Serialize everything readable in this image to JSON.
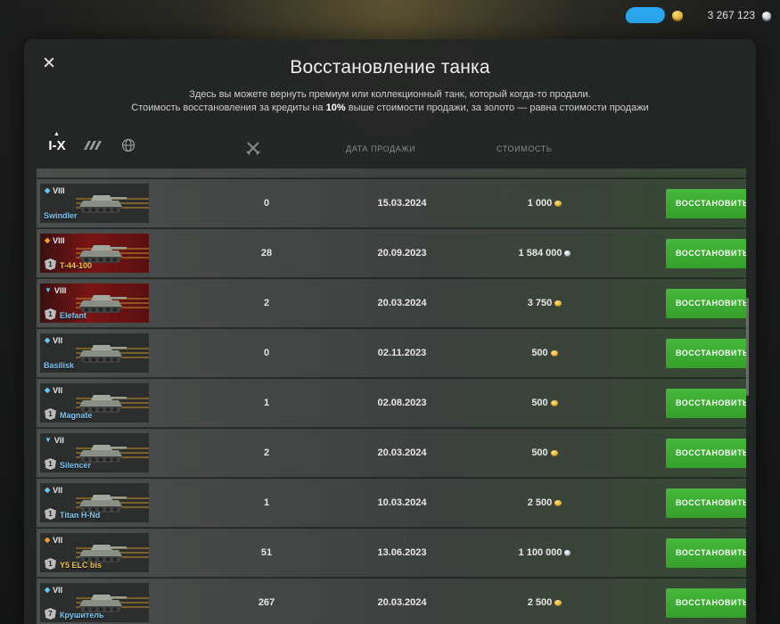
{
  "header": {
    "credits": "3 267 123"
  },
  "modal": {
    "title": "Восстановление танка",
    "desc_line1": "Здесь вы можете вернуть премиум или коллекционный танк, который когда-то продали.",
    "desc_line2_a": "Стоимость восстановления за кредиты на ",
    "desc_line2_b": "10%",
    "desc_line2_c": " выше стоимости продажи, за золото — равна стоимости продажи"
  },
  "filters": {
    "tier_label": "I-X"
  },
  "columns": {
    "date": "ДАТА ПРОДАЖИ",
    "cost": "СТОИМОСТЬ"
  },
  "restore_label": "ВОССТАНОВИТЬ",
  "rows": [
    {
      "tier": "VIII",
      "class": "light",
      "name": "Swindler",
      "battles": "0",
      "date": "15.03.2024",
      "cost": "1 000",
      "currency": "gold",
      "rank": "",
      "red": false
    },
    {
      "tier": "VIII",
      "class": "heavy",
      "name": "T-44-100",
      "battles": "28",
      "date": "20.09.2023",
      "cost": "1 584 000",
      "currency": "silver",
      "rank": "1",
      "red": true
    },
    {
      "tier": "VIII",
      "class": "td",
      "name": "Elefant",
      "battles": "2",
      "date": "20.03.2024",
      "cost": "3 750",
      "currency": "gold",
      "rank": "1",
      "red": true
    },
    {
      "tier": "VII",
      "class": "light",
      "name": "Basilisk",
      "battles": "0",
      "date": "02.11.2023",
      "cost": "500",
      "currency": "gold",
      "rank": "",
      "red": false
    },
    {
      "tier": "VII",
      "class": "light",
      "name": "Magnate",
      "battles": "1",
      "date": "02.08.2023",
      "cost": "500",
      "currency": "gold",
      "rank": "1",
      "red": false
    },
    {
      "tier": "VII",
      "class": "td",
      "name": "Silencer",
      "battles": "2",
      "date": "20.03.2024",
      "cost": "500",
      "currency": "gold",
      "rank": "1",
      "red": false
    },
    {
      "tier": "VII",
      "class": "light",
      "name": "Titan H-Nd",
      "battles": "1",
      "date": "10.03.2024",
      "cost": "2 500",
      "currency": "gold",
      "rank": "1",
      "red": false
    },
    {
      "tier": "VII",
      "class": "heavy",
      "name": "Y5 ELC bis",
      "battles": "51",
      "date": "13.06.2023",
      "cost": "1 100 000",
      "currency": "silver",
      "rank": "1",
      "red": false
    },
    {
      "tier": "VII",
      "class": "light",
      "name": "Крушитель",
      "battles": "267",
      "date": "20.03.2024",
      "cost": "2 500",
      "currency": "gold",
      "rank": "7",
      "red": false
    }
  ]
}
